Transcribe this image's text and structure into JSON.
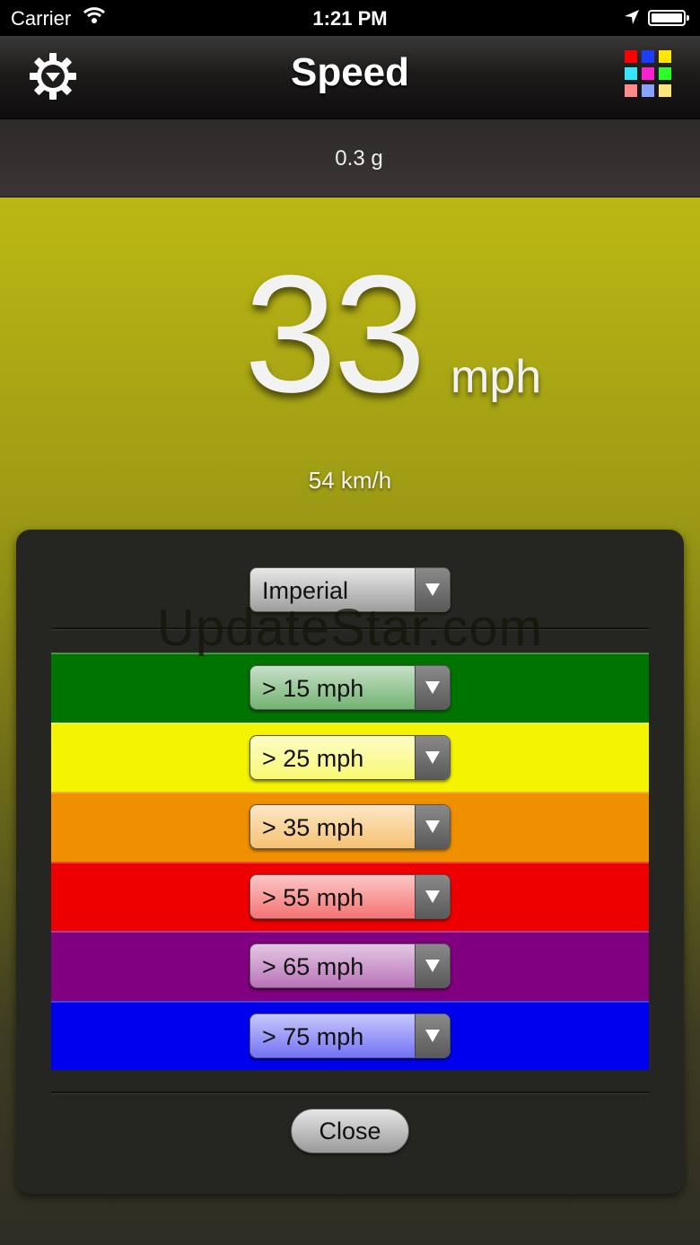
{
  "status_bar": {
    "carrier": "Carrier",
    "time": "1:21 PM"
  },
  "navbar": {
    "title": "Speed",
    "left_icon": "gear-icon",
    "right_icon": "color-grid-icon",
    "grid_colors": [
      "#ff0000",
      "#1e3cff",
      "#ffe600",
      "#33e6ff",
      "#ff1ed2",
      "#2aff2a",
      "#ff8a8a",
      "#8aa0ff",
      "#ffe67a"
    ]
  },
  "g_force": "0.3 g",
  "speed": {
    "value": "33",
    "unit": "mph",
    "secondary": "54 km/h"
  },
  "units_dropdown": {
    "selected": "Imperial"
  },
  "watermark": "UpdateStar.com",
  "thresholds": [
    {
      "label": "> 15 mph",
      "color": "#007400"
    },
    {
      "label": "> 25 mph",
      "color": "#f4f400"
    },
    {
      "label": "> 35 mph",
      "color": "#f09000"
    },
    {
      "label": "> 55 mph",
      "color": "#ee0000"
    },
    {
      "label": "> 65 mph",
      "color": "#800080"
    },
    {
      "label": "> 75 mph",
      "color": "#0000ee"
    }
  ],
  "close_label": "Close"
}
